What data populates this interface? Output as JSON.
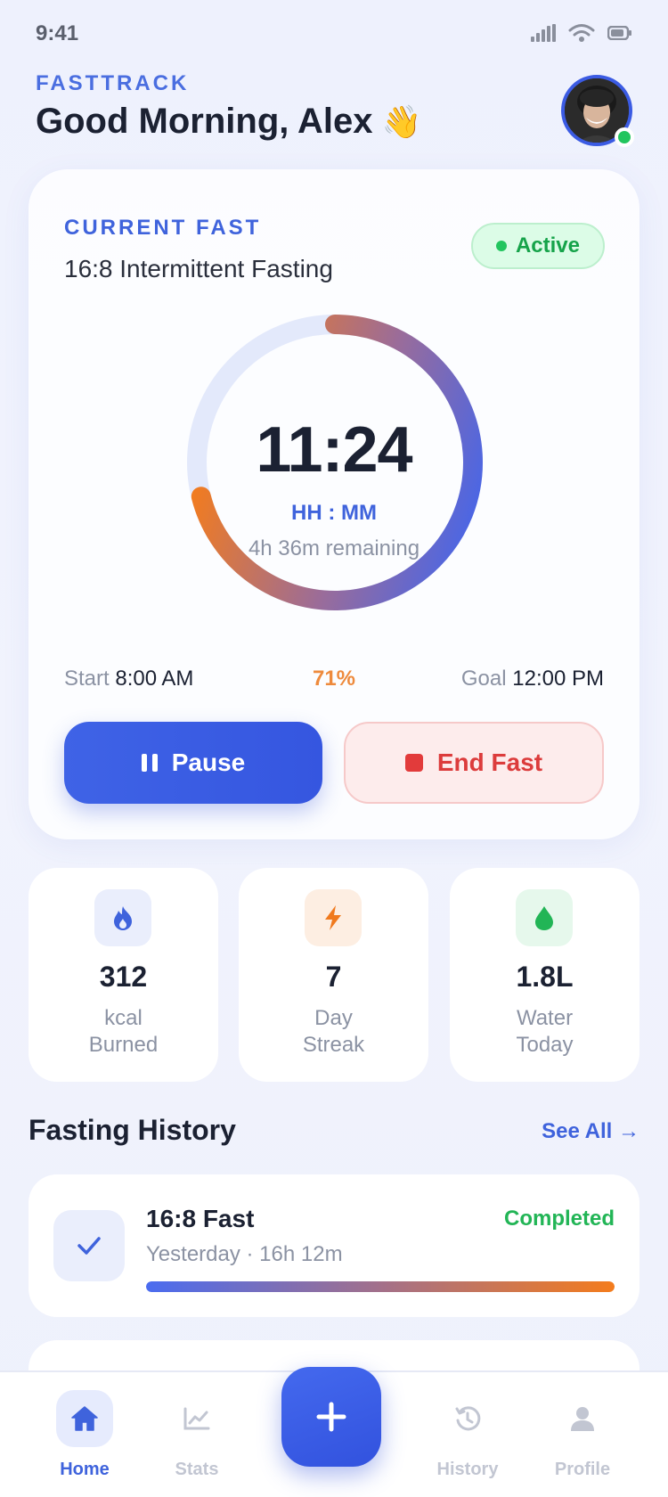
{
  "status_bar": {
    "time": "9:41"
  },
  "header": {
    "app_name": "FASTTRACK",
    "greeting": "Good Morning, Alex",
    "greeting_emoji": "👋"
  },
  "current_fast": {
    "label": "CURRENT FAST",
    "plan": "16:8 Intermittent Fasting",
    "status": "Active",
    "timer": "11:24",
    "timer_unit": "HH : MM",
    "remaining": "4h 36m remaining",
    "progress": 0.71,
    "start_label": "Start",
    "start_time": "8:00 AM",
    "percent_text": "71%",
    "goal_label": "Goal",
    "goal_time": "12:00 PM",
    "pause_label": "Pause",
    "end_label": "End Fast"
  },
  "stats": [
    {
      "icon": "flame-icon",
      "value": "312",
      "label_line1": "kcal",
      "label_line2": "Burned",
      "accent": "#3f63dc"
    },
    {
      "icon": "bolt-icon",
      "value": "7",
      "label_line1": "Day",
      "label_line2": "Streak",
      "accent": "#f07a1e"
    },
    {
      "icon": "droplet-icon",
      "value": "1.8L",
      "label_line1": "Water",
      "label_line2": "Today",
      "accent": "#22b556"
    }
  ],
  "history": {
    "title": "Fasting History",
    "see_all": "See All →",
    "items": [
      {
        "title": "16:8 Fast",
        "status": "Completed",
        "meta": "Yesterday · 16h 12m",
        "progress": 1.0
      }
    ]
  },
  "tab_bar": {
    "tabs": [
      {
        "label": "Home",
        "icon": "home-icon",
        "active": true
      },
      {
        "label": "Stats",
        "icon": "chart-icon",
        "active": false
      },
      {
        "label": "History",
        "icon": "history-icon",
        "active": false
      },
      {
        "label": "Profile",
        "icon": "user-icon",
        "active": false
      }
    ],
    "fab_icon": "plus-icon"
  },
  "colors": {
    "primary": "#3f63dc",
    "accent_orange": "#f47c1c",
    "success": "#22c55e",
    "danger": "#dc3c3c"
  }
}
